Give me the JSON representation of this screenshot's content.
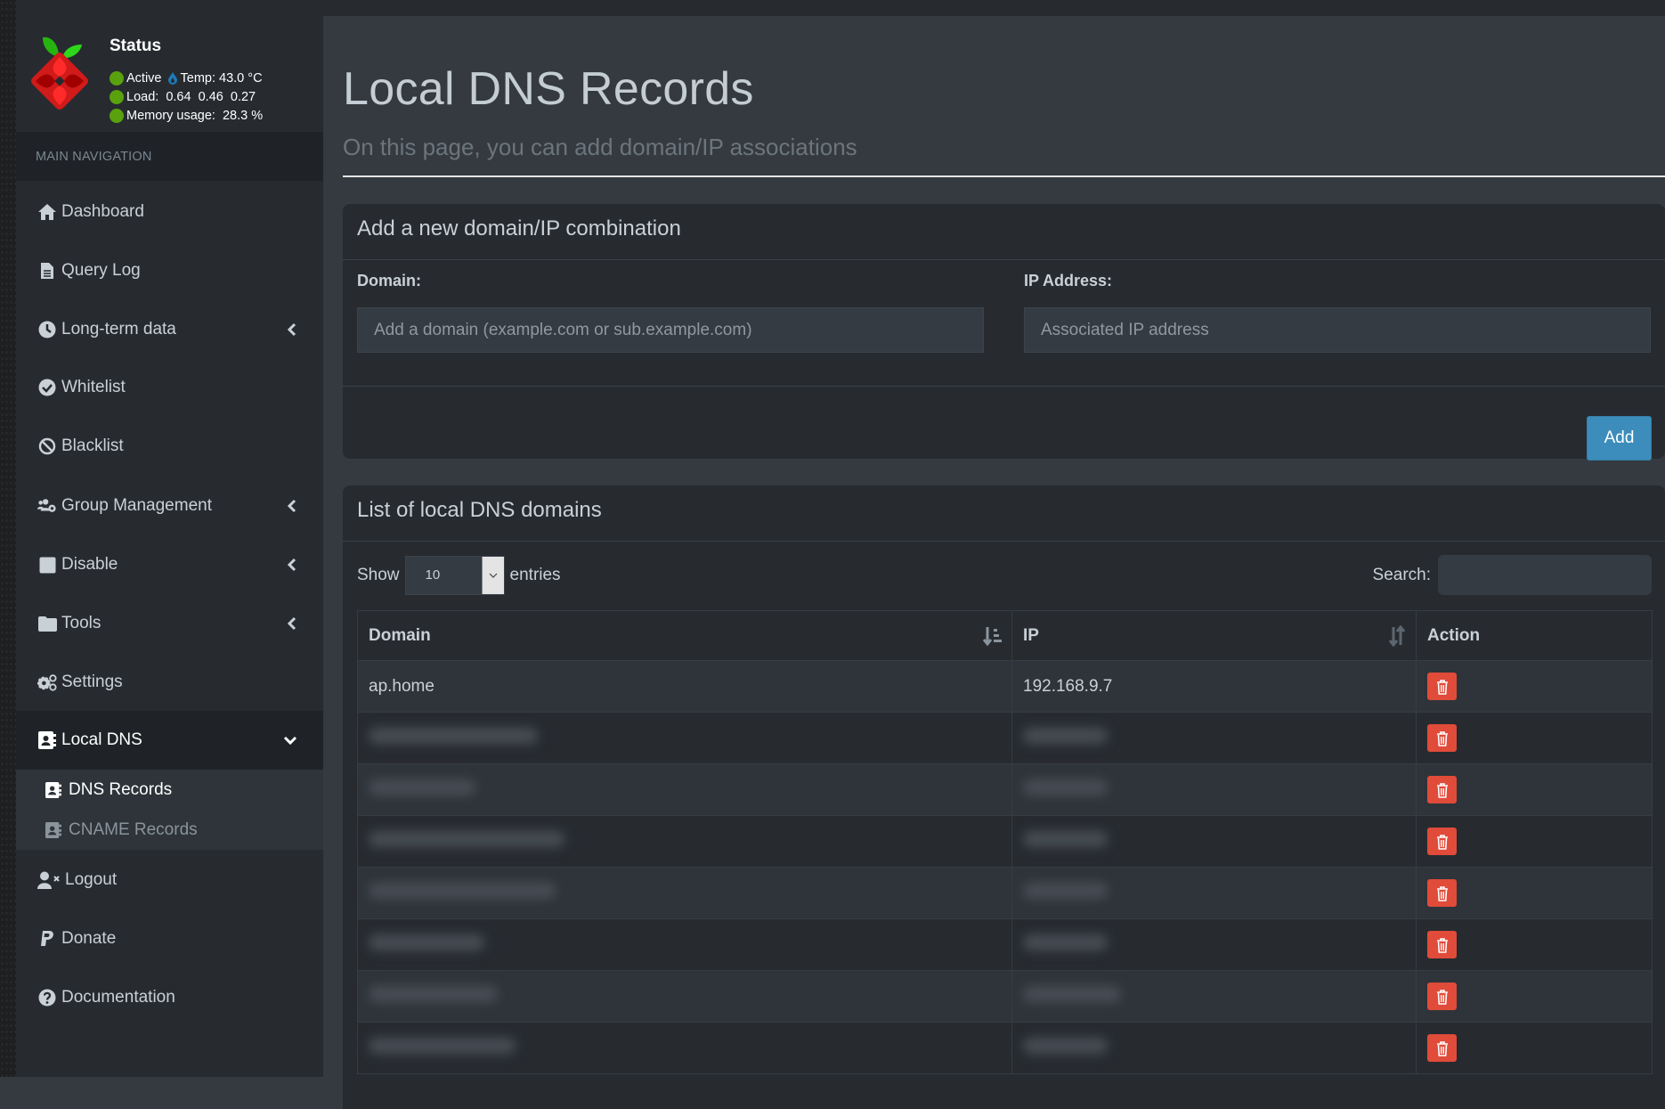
{
  "status": {
    "title": "Status",
    "active_label": "Active",
    "temp_label": "Temp: 43.0 °C",
    "load_label": "Load:  0.64  0.46  0.27",
    "memory_label": "Memory usage:  28.3 %",
    "dot_color": "#5aa10e"
  },
  "sidebar": {
    "section_label": "MAIN NAVIGATION",
    "items": [
      {
        "label": "Dashboard",
        "icon": "home-icon"
      },
      {
        "label": "Query Log",
        "icon": "file-icon"
      },
      {
        "label": "Long-term data",
        "icon": "clock-icon",
        "expandable": true
      },
      {
        "label": "Whitelist",
        "icon": "check-circle-icon"
      },
      {
        "label": "Blacklist",
        "icon": "ban-icon"
      },
      {
        "label": "Group Management",
        "icon": "users-cog-icon",
        "expandable": true
      },
      {
        "label": "Disable",
        "icon": "stop-icon",
        "expandable": true
      },
      {
        "label": "Tools",
        "icon": "folder-icon",
        "expandable": true
      },
      {
        "label": "Settings",
        "icon": "cogs-icon"
      },
      {
        "label": "Local DNS",
        "icon": "address-book-icon",
        "expanded": true
      },
      {
        "label": "Logout",
        "icon": "user-times-icon"
      },
      {
        "label": "Donate",
        "icon": "paypal-icon"
      },
      {
        "label": "Documentation",
        "icon": "question-circle-icon"
      }
    ],
    "local_dns_sub": [
      {
        "label": "DNS Records",
        "active": true
      },
      {
        "label": "CNAME Records",
        "active": false
      }
    ]
  },
  "header": {
    "title": "Local DNS Records",
    "subtitle": "On this page, you can add domain/IP associations"
  },
  "add_box": {
    "title": "Add a new domain/IP combination",
    "domain_label": "Domain:",
    "domain_placeholder": "Add a domain (example.com or sub.example.com)",
    "domain_value": "",
    "ip_label": "IP Address:",
    "ip_placeholder": "Associated IP address",
    "ip_value": "",
    "add_label": "Add",
    "accent": "#3c8dbc"
  },
  "list_box": {
    "title": "List of local DNS domains",
    "show_label": "Show",
    "entries_label": "entries",
    "page_length": "10",
    "search_label": "Search:",
    "search_value": "",
    "columns": [
      "Domain",
      "IP",
      "Action"
    ],
    "rows": [
      {
        "domain": "ap.home",
        "ip": "192.168.9.7",
        "blurred": false
      },
      {
        "domain": "",
        "ip": "",
        "blurred": true
      },
      {
        "domain": "",
        "ip": "",
        "blurred": true
      },
      {
        "domain": "",
        "ip": "",
        "blurred": true
      },
      {
        "domain": "",
        "ip": "",
        "blurred": true
      },
      {
        "domain": "",
        "ip": "",
        "blurred": true
      },
      {
        "domain": "",
        "ip": "",
        "blurred": true
      },
      {
        "domain": "",
        "ip": "",
        "blurred": true
      }
    ],
    "delete_color": "#e04b3a"
  }
}
